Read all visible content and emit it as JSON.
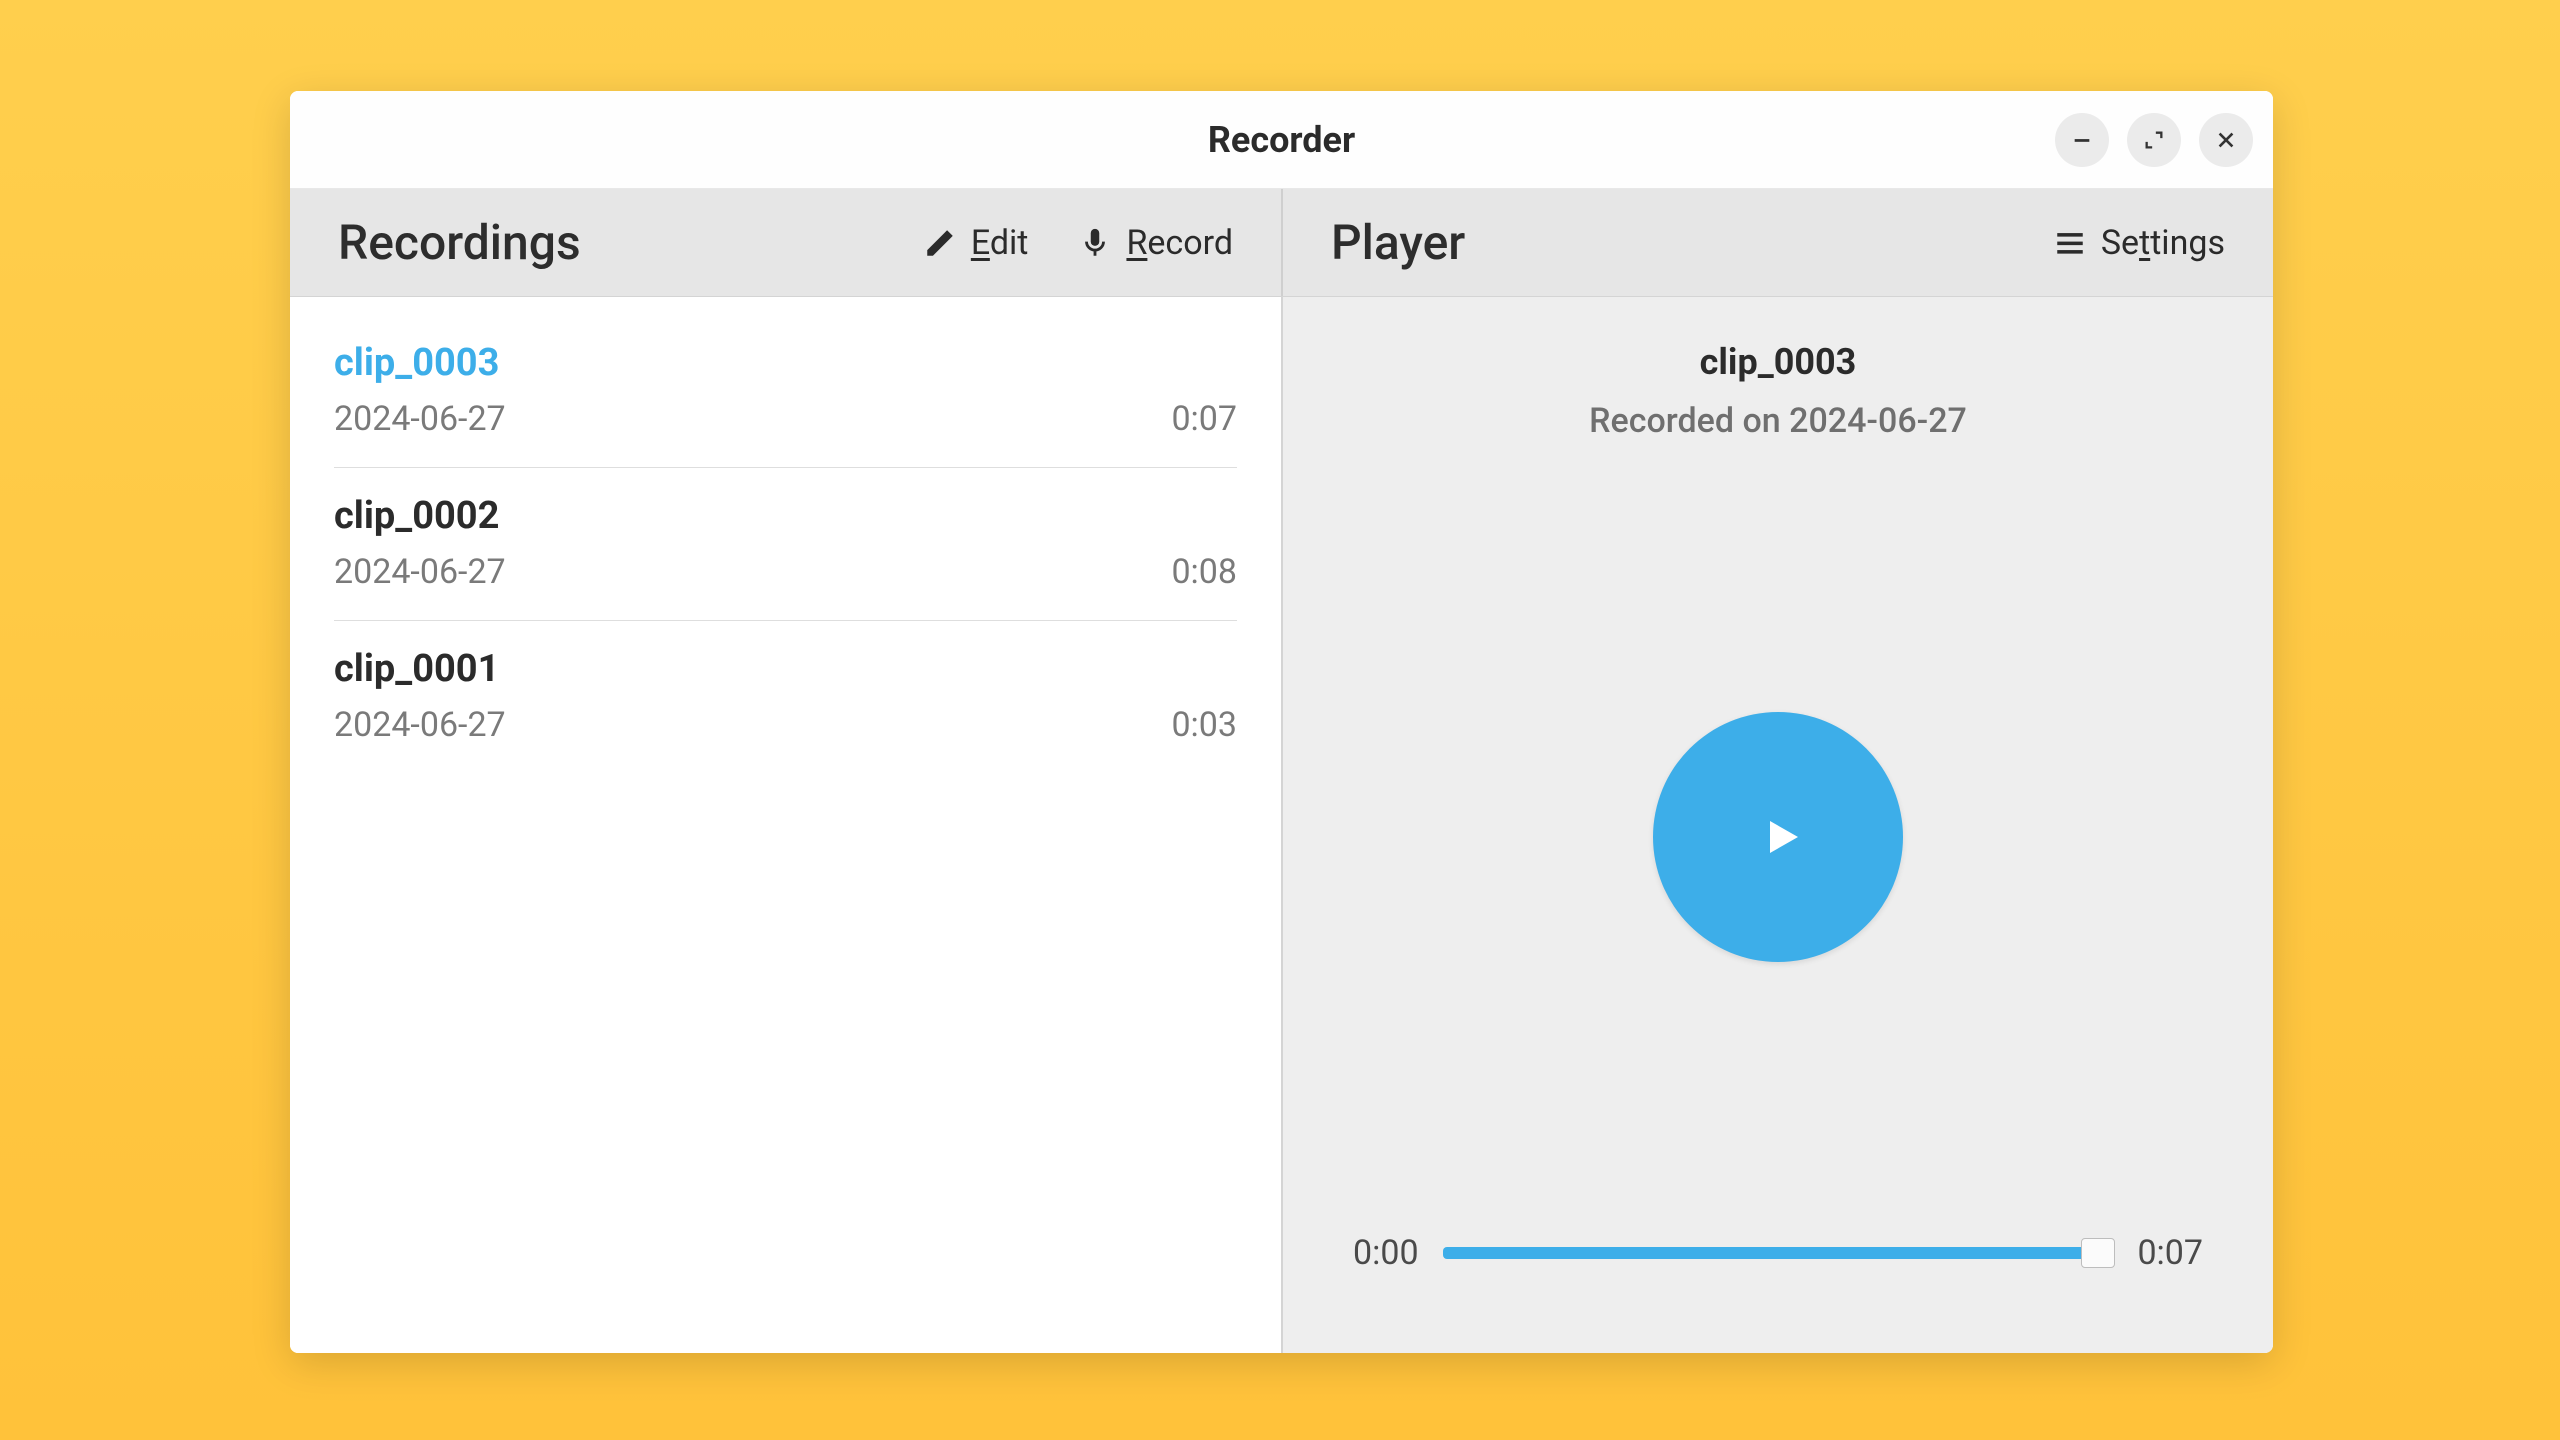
{
  "window": {
    "title": "Recorder"
  },
  "toolbar": {
    "left_title": "Recordings",
    "right_title": "Player",
    "edit_label": "Edit",
    "record_label": "Record",
    "settings_label": "Settings"
  },
  "recordings": [
    {
      "name": "clip_0003",
      "date": "2024-06-27",
      "duration": "0:07",
      "selected": true
    },
    {
      "name": "clip_0002",
      "date": "2024-06-27",
      "duration": "0:08",
      "selected": false
    },
    {
      "name": "clip_0001",
      "date": "2024-06-27",
      "duration": "0:03",
      "selected": false
    }
  ],
  "player": {
    "current_name": "clip_0003",
    "subtitle": "Recorded on 2024-06-27",
    "time_elapsed": "0:00",
    "time_total": "0:07"
  },
  "colors": {
    "accent": "#3daee9"
  }
}
